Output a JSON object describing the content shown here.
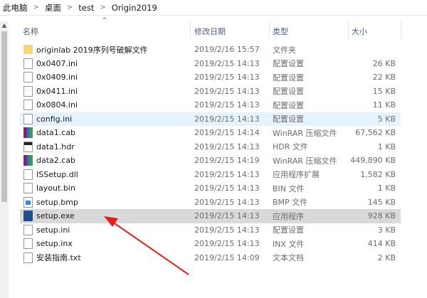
{
  "breadcrumb": [
    "此电脑",
    "桌面",
    "test",
    "Origin2019"
  ],
  "columns": {
    "name": "名称",
    "date": "修改日期",
    "type": "类型",
    "size": "大小"
  },
  "files": [
    {
      "name": "originlab 2019序列号破解文件",
      "date": "2019/2/16 15:57",
      "type": "文件夹",
      "size": "",
      "icon": "folder-icon"
    },
    {
      "name": "0x0407.ini",
      "date": "2019/2/15 14:13",
      "type": "配置设置",
      "size": "26 KB",
      "icon": "settings-file-icon"
    },
    {
      "name": "0x0409.ini",
      "date": "2019/2/15 14:13",
      "type": "配置设置",
      "size": "22 KB",
      "icon": "settings-file-icon"
    },
    {
      "name": "0x0411.ini",
      "date": "2019/2/15 14:13",
      "type": "配置设置",
      "size": "15 KB",
      "icon": "settings-file-icon"
    },
    {
      "name": "0x0804.ini",
      "date": "2019/2/15 14:13",
      "type": "配置设置",
      "size": "11 KB",
      "icon": "settings-file-icon"
    },
    {
      "name": "config.ini",
      "date": "2019/2/15 14:13",
      "type": "配置设置",
      "size": "5 KB",
      "icon": "settings-file-icon"
    },
    {
      "name": "data1.cab",
      "date": "2019/2/15 14:14",
      "type": "WinRAR 压缩文件",
      "size": "67,562 KB",
      "icon": "winrar-icon"
    },
    {
      "name": "data1.hdr",
      "date": "2019/2/15 14:13",
      "type": "HDR 文件",
      "size": "1 KB",
      "icon": "hdr-file-icon"
    },
    {
      "name": "data2.cab",
      "date": "2019/2/15 14:19",
      "type": "WinRAR 压缩文件",
      "size": "449,890 KB",
      "icon": "winrar-icon"
    },
    {
      "name": "ISSetup.dll",
      "date": "2019/2/15 14:13",
      "type": "应用程序扩展",
      "size": "1,582 KB",
      "icon": "dll-file-icon"
    },
    {
      "name": "layout.bin",
      "date": "2019/2/15 14:13",
      "type": "BIN 文件",
      "size": "1 KB",
      "icon": "blank-file-icon"
    },
    {
      "name": "setup.bmp",
      "date": "2019/2/15 14:13",
      "type": "BMP 文件",
      "size": "145 KB",
      "icon": "bmp-file-icon"
    },
    {
      "name": "setup.exe",
      "date": "2019/2/15 14:13",
      "type": "应用程序",
      "size": "928 KB",
      "icon": "installer-icon"
    },
    {
      "name": "setup.ini",
      "date": "2019/2/15 14:13",
      "type": "配置设置",
      "size": "3 KB",
      "icon": "settings-file-icon"
    },
    {
      "name": "setup.inx",
      "date": "2019/2/15 14:13",
      "type": "INX 文件",
      "size": "414 KB",
      "icon": "blank-file-icon"
    },
    {
      "name": "安装指南.txt",
      "date": "2019/2/15 14:09",
      "type": "文本文档",
      "size": "2 KB",
      "icon": "text-file-icon"
    }
  ],
  "colors": {
    "hover": "#e5f3ff",
    "selected": "#d9d9d9",
    "arrow": "#e0201b"
  }
}
